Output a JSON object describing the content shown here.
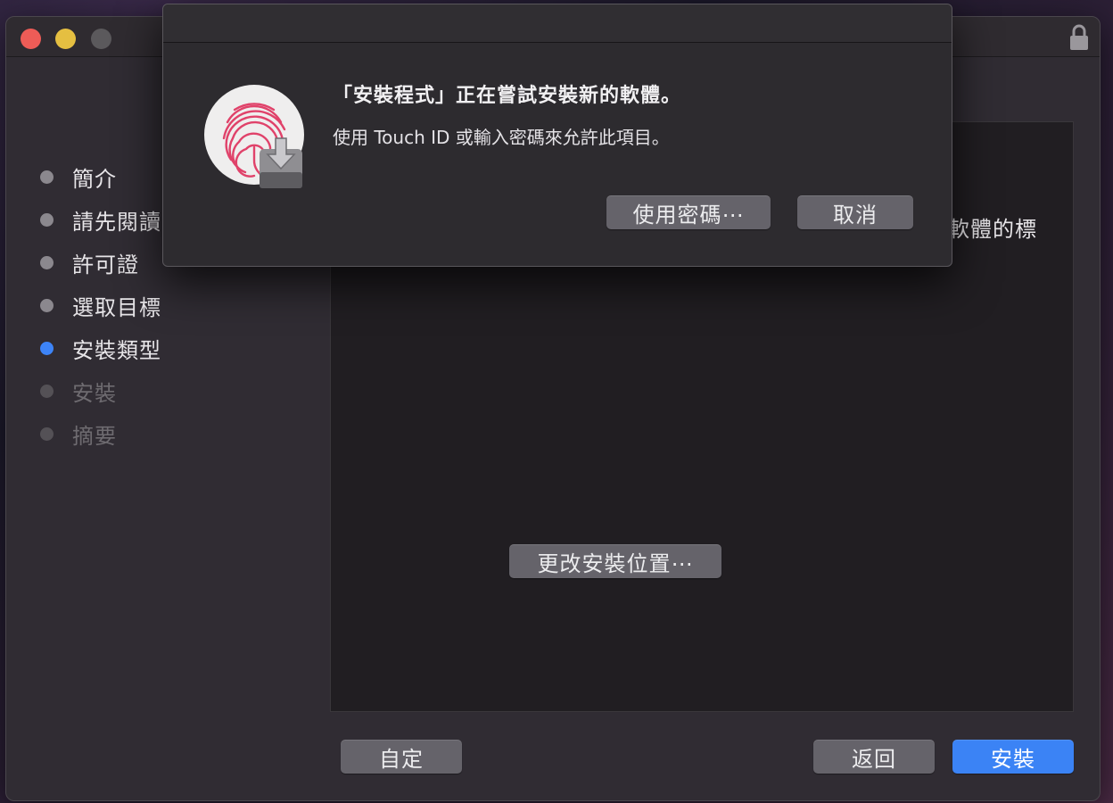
{
  "window": {
    "steps": [
      {
        "label": "簡介",
        "state": "done"
      },
      {
        "label": "請先閱讀",
        "state": "done"
      },
      {
        "label": "許可證",
        "state": "done"
      },
      {
        "label": "選取目標",
        "state": "done"
      },
      {
        "label": "安裝類型",
        "state": "active"
      },
      {
        "label": "安裝",
        "state": "pending"
      },
      {
        "label": "摘要",
        "state": "pending"
      }
    ],
    "content_text": "軟體的標",
    "buttons": {
      "change_location": "更改安裝位置⋯",
      "customize": "自定",
      "back": "返回",
      "install": "安裝"
    }
  },
  "dialog": {
    "title": "「安裝程式」正在嘗試安裝新的軟體。",
    "message": "使用 Touch ID 或輸入密碼來允許此項目。",
    "use_password_label": "使用密碼⋯",
    "cancel_label": "取消"
  },
  "colors": {
    "accent": "#3b83f5",
    "close": "#ee5c57",
    "minimize": "#e5bf41",
    "fingerprint": "#e0426a"
  }
}
